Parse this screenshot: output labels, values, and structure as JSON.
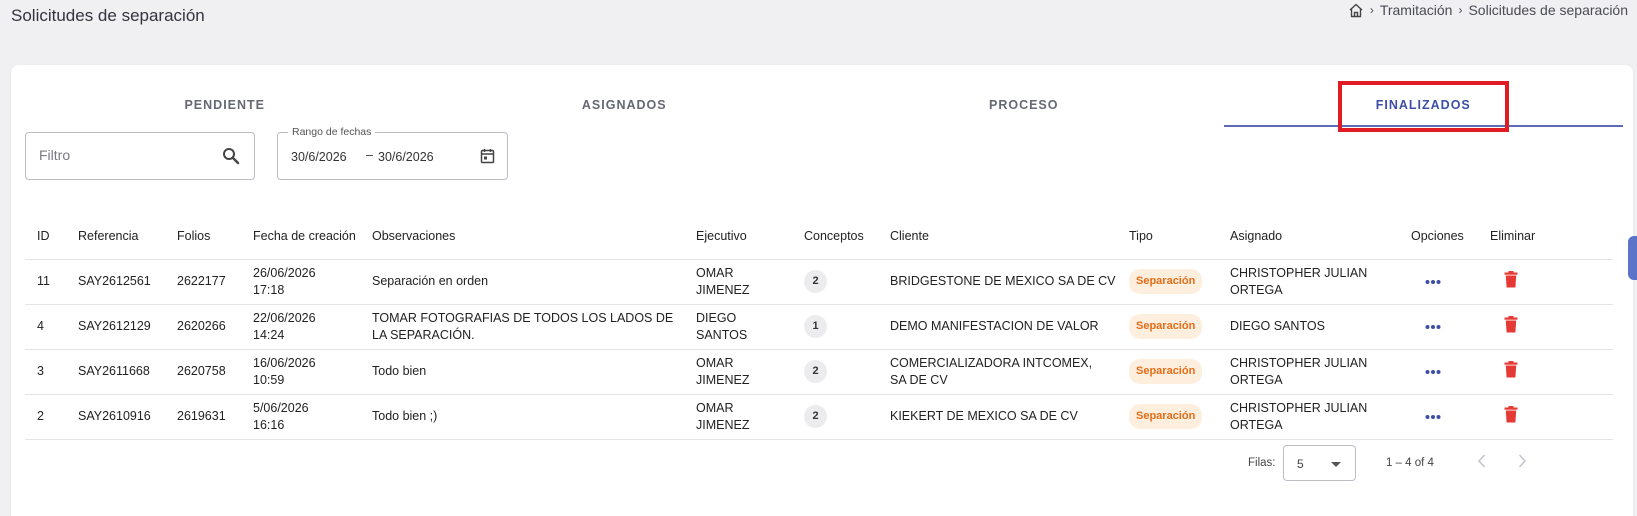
{
  "page": {
    "title": "Solicitudes de separación"
  },
  "breadcrumb": {
    "home_icon": "home-icon",
    "items": [
      "Tramitación",
      "Solicitudes de separación"
    ]
  },
  "tabs": [
    {
      "label": "PENDIENTE",
      "active": false
    },
    {
      "label": "ASIGNADOS",
      "active": false
    },
    {
      "label": "PROCESO",
      "active": false
    },
    {
      "label": "FINALIZADOS",
      "active": true
    }
  ],
  "filter": {
    "placeholder": "Filtro",
    "icon": "search-icon"
  },
  "date_range": {
    "label": "Rango de fechas",
    "start": "30/6/2026",
    "separator": "–",
    "end": "30/6/2026",
    "icon": "calendar-icon"
  },
  "table": {
    "columns": [
      "ID",
      "Referencia",
      "Folios",
      "Fecha de creación",
      "Observaciones",
      "Ejecutivo",
      "Conceptos",
      "Cliente",
      "Tipo",
      "Asignado",
      "Opciones",
      "Eliminar"
    ],
    "rows": [
      {
        "id": "11",
        "referencia": "SAY2612561",
        "folios": "2622177",
        "fecha": "26/06/2026 17:18",
        "observaciones": "Separación en orden",
        "ejecutivo": "OMAR JIMENEZ",
        "conceptos": "2",
        "cliente": "BRIDGESTONE DE MEXICO SA DE CV",
        "tipo": "Separación",
        "asignado": "CHRISTOPHER JULIAN ORTEGA"
      },
      {
        "id": "4",
        "referencia": "SAY2612129",
        "folios": "2620266",
        "fecha": "22/06/2026 14:24",
        "observaciones": "TOMAR FOTOGRAFIAS DE TODOS LOS LADOS DE LA SEPARACIÓN.",
        "ejecutivo": "DIEGO SANTOS",
        "conceptos": "1",
        "cliente": "DEMO MANIFESTACION DE VALOR",
        "tipo": "Separación",
        "asignado": "DIEGO SANTOS"
      },
      {
        "id": "3",
        "referencia": "SAY2611668",
        "folios": "2620758",
        "fecha": "16/06/2026 10:59",
        "observaciones": "Todo bien",
        "ejecutivo": "OMAR JIMENEZ",
        "conceptos": "2",
        "cliente": "COMERCIALIZADORA INTCOMEX, SA DE CV",
        "tipo": "Separación",
        "asignado": "CHRISTOPHER JULIAN ORTEGA"
      },
      {
        "id": "2",
        "referencia": "SAY2610916",
        "folios": "2619631",
        "fecha": "5/06/2026 16:16",
        "observaciones": "Todo bien ;)",
        "ejecutivo": "OMAR JIMENEZ",
        "conceptos": "2",
        "cliente": "KIEKERT DE MEXICO SA DE CV",
        "tipo": "Separación",
        "asignado": "CHRISTOPHER JULIAN ORTEGA"
      }
    ]
  },
  "pagination": {
    "rows_label": "Filas:",
    "rows_value": "5",
    "range": "1 – 4 of 4"
  },
  "colors": {
    "accent": "#3d4fa8",
    "delete": "#e53935",
    "badge_text": "#e56d18",
    "badge_bg": "#fdeede",
    "highlight": "#e01b24"
  }
}
